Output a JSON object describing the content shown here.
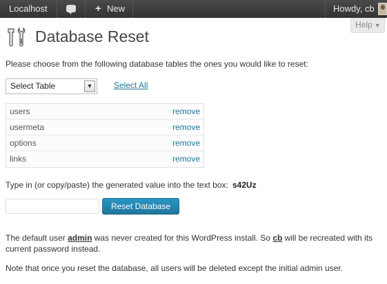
{
  "adminbar": {
    "site_name": "Localhost",
    "new_label": "New",
    "account_label": "Howdy, cb"
  },
  "help": {
    "label": "Help"
  },
  "page": {
    "title": "Database Reset",
    "intro": "Please choose from the following database tables the ones you would like to reset:"
  },
  "table_select": {
    "value": "Select Table"
  },
  "select_all_label": "Select All",
  "tables": [
    {
      "name": "users",
      "action": "remove"
    },
    {
      "name": "usermeta",
      "action": "remove"
    },
    {
      "name": "options",
      "action": "remove"
    },
    {
      "name": "links",
      "action": "remove"
    }
  ],
  "confirm": {
    "text": "Type in (or copy/paste) the generated value into the text box:",
    "code": "s42Uz",
    "input_value": ""
  },
  "reset_button_label": "Reset Database",
  "notes": {
    "user_pre": "The default user",
    "default_user": "admin",
    "user_mid": "was never created for this WordPress install. So",
    "current_user": "cb",
    "user_post": "will be recreated with its current password instead.",
    "warning": "Note that once you reset the database, all users will be deleted except the initial admin user."
  },
  "colors": {
    "link": "#21759b",
    "adminbar_bg": "#333333",
    "button_bg": "#21759b"
  }
}
